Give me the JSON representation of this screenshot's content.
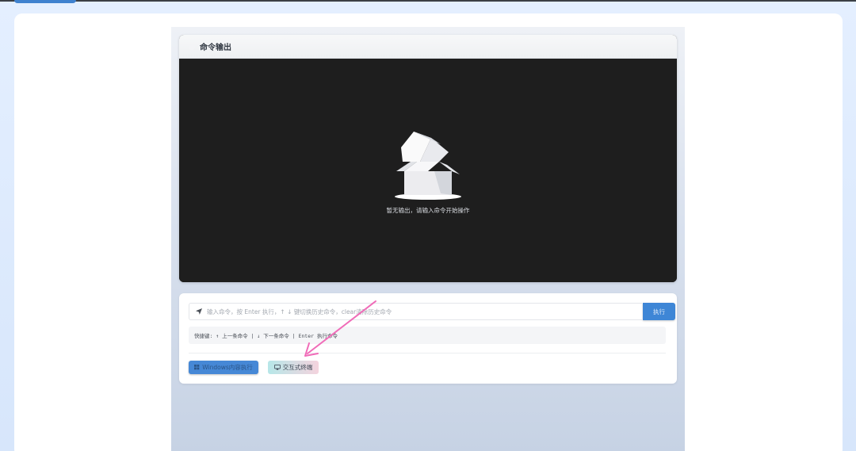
{
  "output": {
    "title": "命令输出",
    "empty_text": "暂无输出，请输入命令开始操作"
  },
  "command": {
    "placeholder": "输入命令，按 Enter 执行，↑ ↓ 键切换历史命令，clear清除历史命令",
    "value": "",
    "run_label": "执行",
    "hint": "快捷键: ↑ 上一条命令 | ↓ 下一条命令 | Enter 执行命令"
  },
  "actions": {
    "windows_label": "Windows内容执行",
    "terminal_label": "交互式终端"
  },
  "colors": {
    "accent": "#3e86d6",
    "terminal_bg": "#1e1e1e",
    "annotation_arrow": "#f06bb8"
  }
}
